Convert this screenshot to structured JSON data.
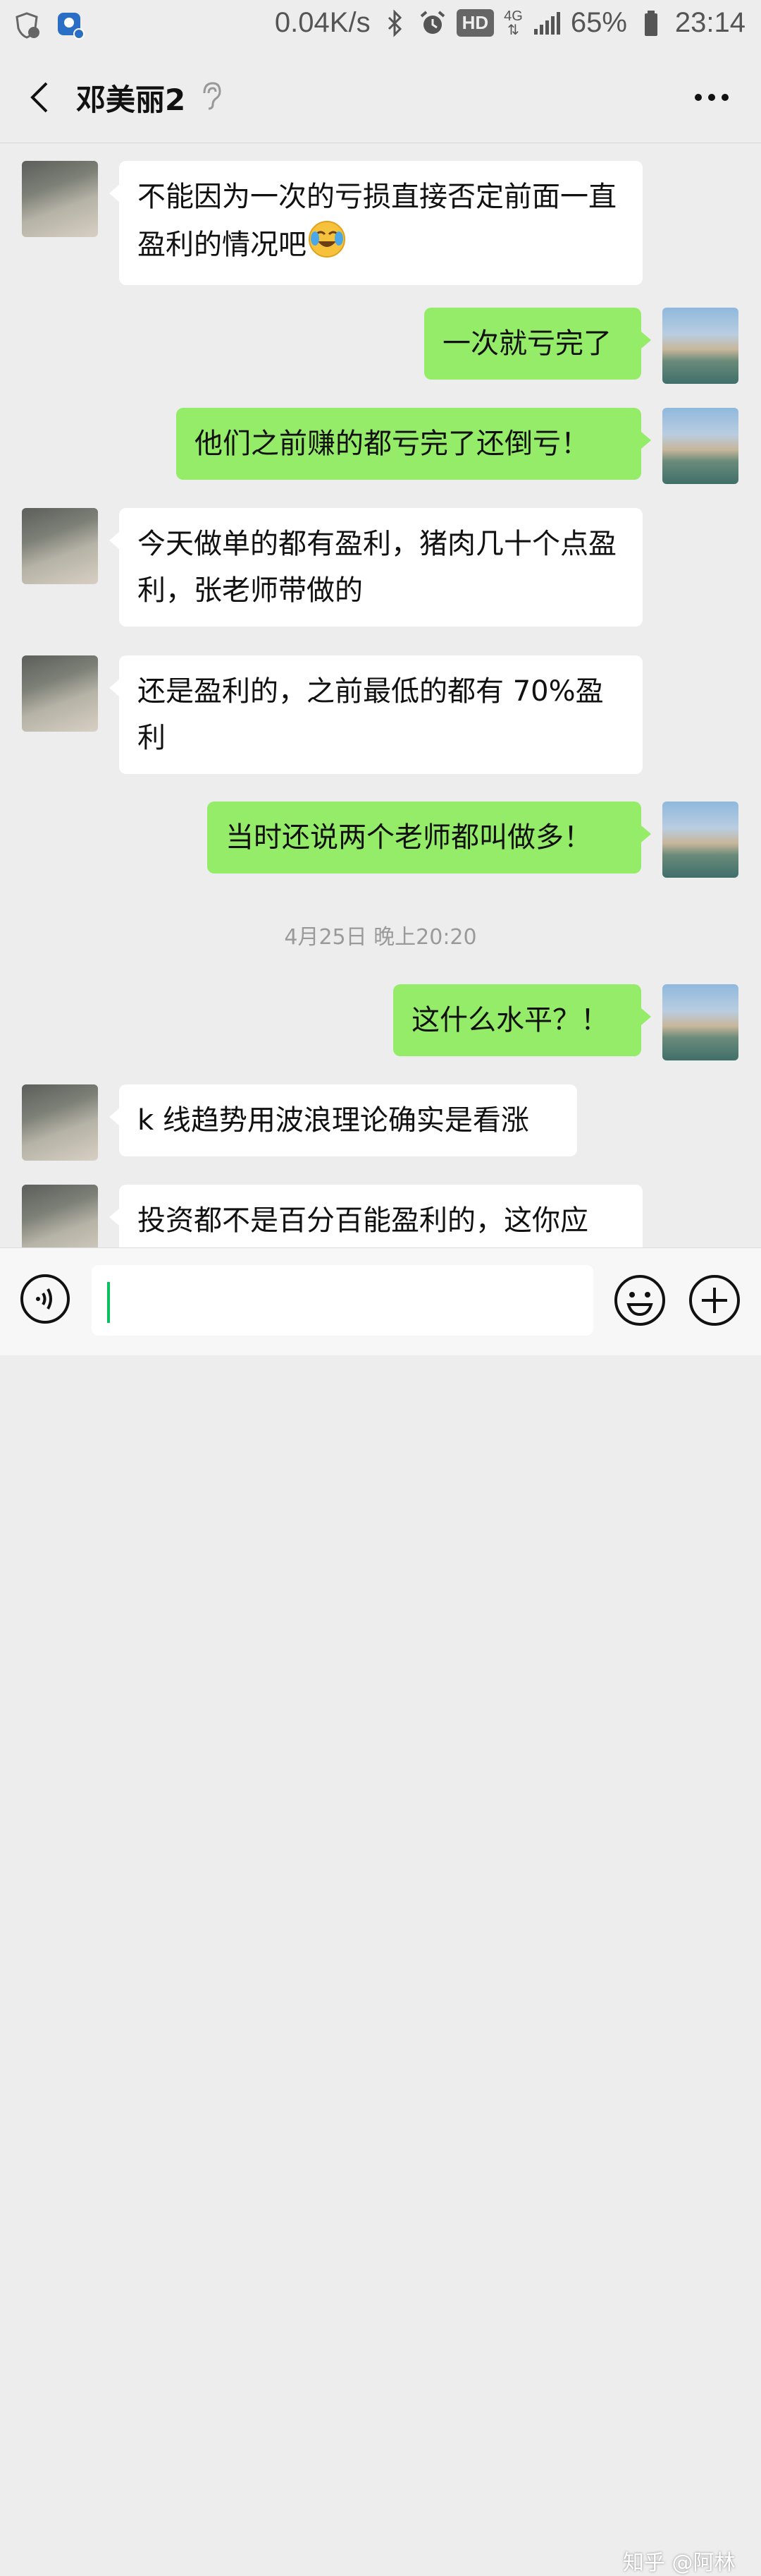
{
  "status_bar": {
    "network_speed": "0.04K/s",
    "hd_label": "HD",
    "network_type": "4G",
    "battery": "65%",
    "time": "23:14"
  },
  "header": {
    "title": "邓美丽2"
  },
  "messages": [
    {
      "side": "received",
      "text": "不能因为一次的亏损直接否定前面一直盈利的情况吧",
      "emoji": "tears-of-joy-face-icon"
    },
    {
      "side": "sent",
      "text": "一次就亏完了"
    },
    {
      "side": "sent",
      "text": "他们之前赚的都亏完了还倒亏！"
    },
    {
      "side": "received",
      "text": "今天做单的都有盈利，猪肉几十个点盈利，张老师带做的"
    },
    {
      "side": "received",
      "text": "还是盈利的，之前最低的都有 70%盈利"
    },
    {
      "side": "sent",
      "text": "当时还说两个老师都叫做多！"
    },
    {
      "side": "timestamp",
      "text": "4月25日 晚上20:20"
    },
    {
      "side": "sent",
      "text": "这什么水平？！"
    },
    {
      "side": "received",
      "text": "k 线趋势用波浪理论确实是看涨"
    },
    {
      "side": "received",
      "text": "投资都不是百分百能盈利的，这你应"
    }
  ],
  "input_bar": {
    "text_value": ""
  },
  "watermark": "知乎 @阿林",
  "colors": {
    "background": "#ededed",
    "sent_bubble": "#95ec69",
    "received_bubble": "#ffffff",
    "caret": "#07c160"
  }
}
